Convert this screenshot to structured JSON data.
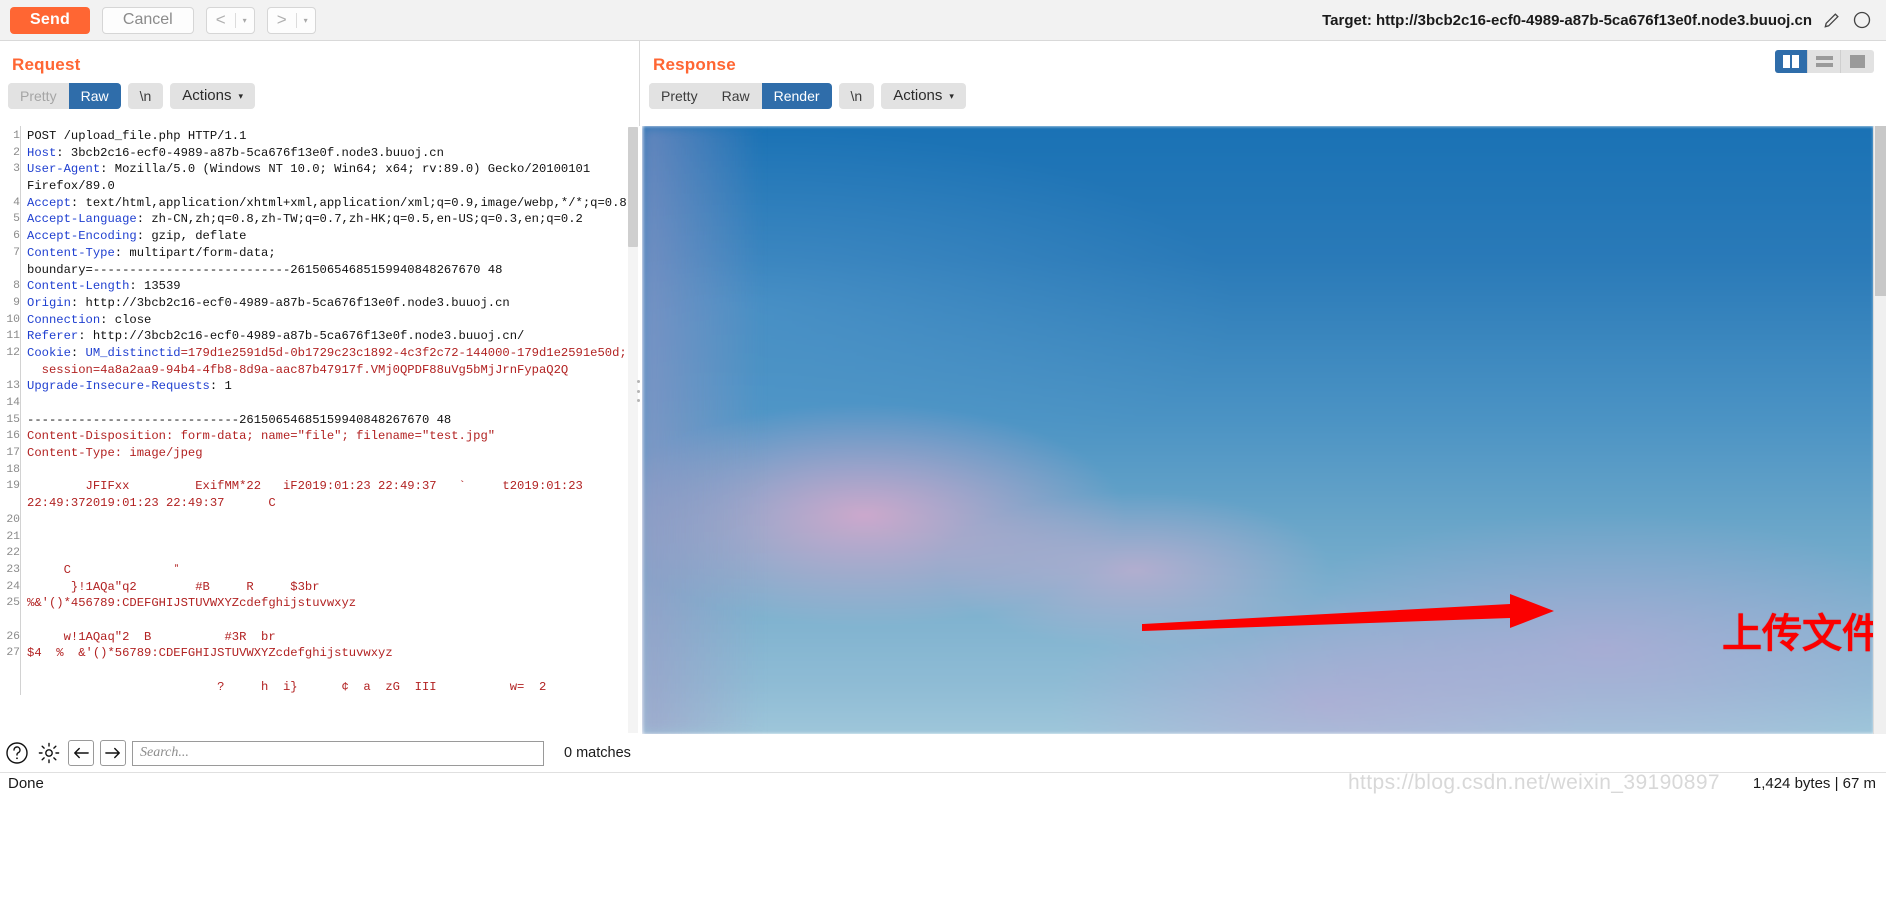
{
  "toolbar": {
    "send_label": "Send",
    "cancel_label": "Cancel",
    "prev_label": "<",
    "prev_caret": "▾",
    "next_label": ">",
    "next_caret": "▾",
    "target_label": "Target: http://3bcb2c16-ecf0-4989-a87b-5ca676f13e0f.node3.buuoj.cn",
    "pencil_icon": "pencil-icon",
    "circle_icon": "circle-icon",
    "accent_color": "#ff6633"
  },
  "request": {
    "title": "Request",
    "tabs": [
      {
        "label": "Pretty",
        "active": false,
        "muted": true
      },
      {
        "label": "Raw",
        "active": true,
        "muted": false
      }
    ],
    "newline_label": "\\n",
    "actions_label": "Actions",
    "actions_caret": "▾",
    "lines": [
      {
        "n": "1",
        "text": "POST /upload_file.php HTTP/1.1"
      },
      {
        "n": "2",
        "text": "Host: 3bcb2c16-ecf0-4989-a87b-5ca676f13e0f.node3.buuoj.cn"
      },
      {
        "n": "3",
        "text": "User-Agent: Mozilla/5.0 (Windows NT 10.0; Win64; x64; rv:89.0) Gecko/20100101"
      },
      {
        "n": "",
        "text": "Firefox/89.0"
      },
      {
        "n": "4",
        "text": "Accept: text/html,application/xhtml+xml,application/xml;q=0.9,image/webp,*/*;q=0.8"
      },
      {
        "n": "5",
        "text": "Accept-Language: zh-CN,zh;q=0.8,zh-TW;q=0.7,zh-HK;q=0.5,en-US;q=0.3,en;q=0.2"
      },
      {
        "n": "6",
        "text": "Accept-Encoding: gzip, deflate"
      },
      {
        "n": "7",
        "text": "Content-Type: multipart/form-data;"
      },
      {
        "n": "",
        "text": "boundary=---------------------------26150654685159940848267670 48"
      },
      {
        "n": "8",
        "text": "Content-Length: 13539"
      },
      {
        "n": "9",
        "text": "Origin: http://3bcb2c16-ecf0-4989-a87b-5ca676f13e0f.node3.buuoj.cn"
      },
      {
        "n": "10",
        "text": "Connection: close"
      },
      {
        "n": "11",
        "text": "Referer: http://3bcb2c16-ecf0-4989-a87b-5ca676f13e0f.node3.buuoj.cn/"
      },
      {
        "n": "12",
        "text": "Cookie: UM_distinctid=179d1e2591d5d-0b1729c23c1892-4c3f2c72-144000-179d1e2591e50d;"
      },
      {
        "n": "",
        "text": "  session=4a8a2aa9-94b4-4fb8-8d9a-aac87b47917f.VMj0QPDF88uVg5bMjJrnFypaQ2Q"
      },
      {
        "n": "13",
        "text": "Upgrade-Insecure-Requests: 1"
      },
      {
        "n": "14",
        "text": ""
      },
      {
        "n": "15",
        "text": "-----------------------------26150654685159940848267670 48"
      },
      {
        "n": "16",
        "text": "Content-Disposition: form-data; name=\"file\"; filename=\"test.jpg\""
      },
      {
        "n": "17",
        "text": "Content-Type: image/jpeg"
      },
      {
        "n": "18",
        "text": ""
      },
      {
        "n": "19",
        "text": "        JFIFxx         ExifMM*22   iF2019:01:23 22:49:37   `     t2019:01:23"
      },
      {
        "n": "",
        "text": "22:49:372019:01:23 22:49:37      C"
      },
      {
        "n": "20",
        "text": ""
      },
      {
        "n": "21",
        "text": ""
      },
      {
        "n": "22",
        "text": ""
      },
      {
        "n": "23",
        "text": "     C              ˮ"
      },
      {
        "n": "24",
        "text": "      }!1AQa\"q2        #B     R     $3br"
      },
      {
        "n": "25",
        "text": "%&'()*456789:CDEFGHIJSTUVWXYZcdefghijstuvwxyz"
      },
      {
        "n": "",
        "text": ""
      },
      {
        "n": "26",
        "text": "     w!1AQaq\"2  B          #3R  br"
      },
      {
        "n": "27",
        "text": "$4  %  &'()*56789:CDEFGHIJSTUVWXYZcdefghijstuvwxyz"
      },
      {
        "n": "",
        "text": ""
      },
      {
        "n": "",
        "text": "                          ?     h  i}      ¢  a  zG  III          w=  2"
      }
    ],
    "highlight_text": "j",
    "highlight_color": "#ffb380"
  },
  "response": {
    "title": "Response",
    "tabs": [
      {
        "label": "Pretty",
        "active": false
      },
      {
        "label": "Raw",
        "active": false
      },
      {
        "label": "Render",
        "active": true
      }
    ],
    "newline_label": "\\n",
    "actions_label": "Actions",
    "actions_caret": "▾",
    "annotation_text": "上传文件名: test.jpg",
    "annotation_color": "#fb0000",
    "arrow_color": "#fb0000",
    "rendered_content": "blurry blue sky photograph with pink clouds"
  },
  "layout_toggle": {
    "options": [
      {
        "name": "split-vertical",
        "active": true
      },
      {
        "name": "split-horizontal",
        "active": false
      },
      {
        "name": "single-pane",
        "active": false
      }
    ]
  },
  "searchbar": {
    "help_icon": "question-mark-icon",
    "settings_icon": "gear-icon",
    "back_icon": "arrow-left-icon",
    "forward_icon": "arrow-right-icon",
    "search_placeholder": "Search...",
    "search_value": "",
    "matches_label": "0 matches"
  },
  "statusbar": {
    "status_text": "Done",
    "bytes_label": "1,424 bytes | 67 m",
    "watermark": "https://blog.csdn.net/weixin_39190897"
  }
}
